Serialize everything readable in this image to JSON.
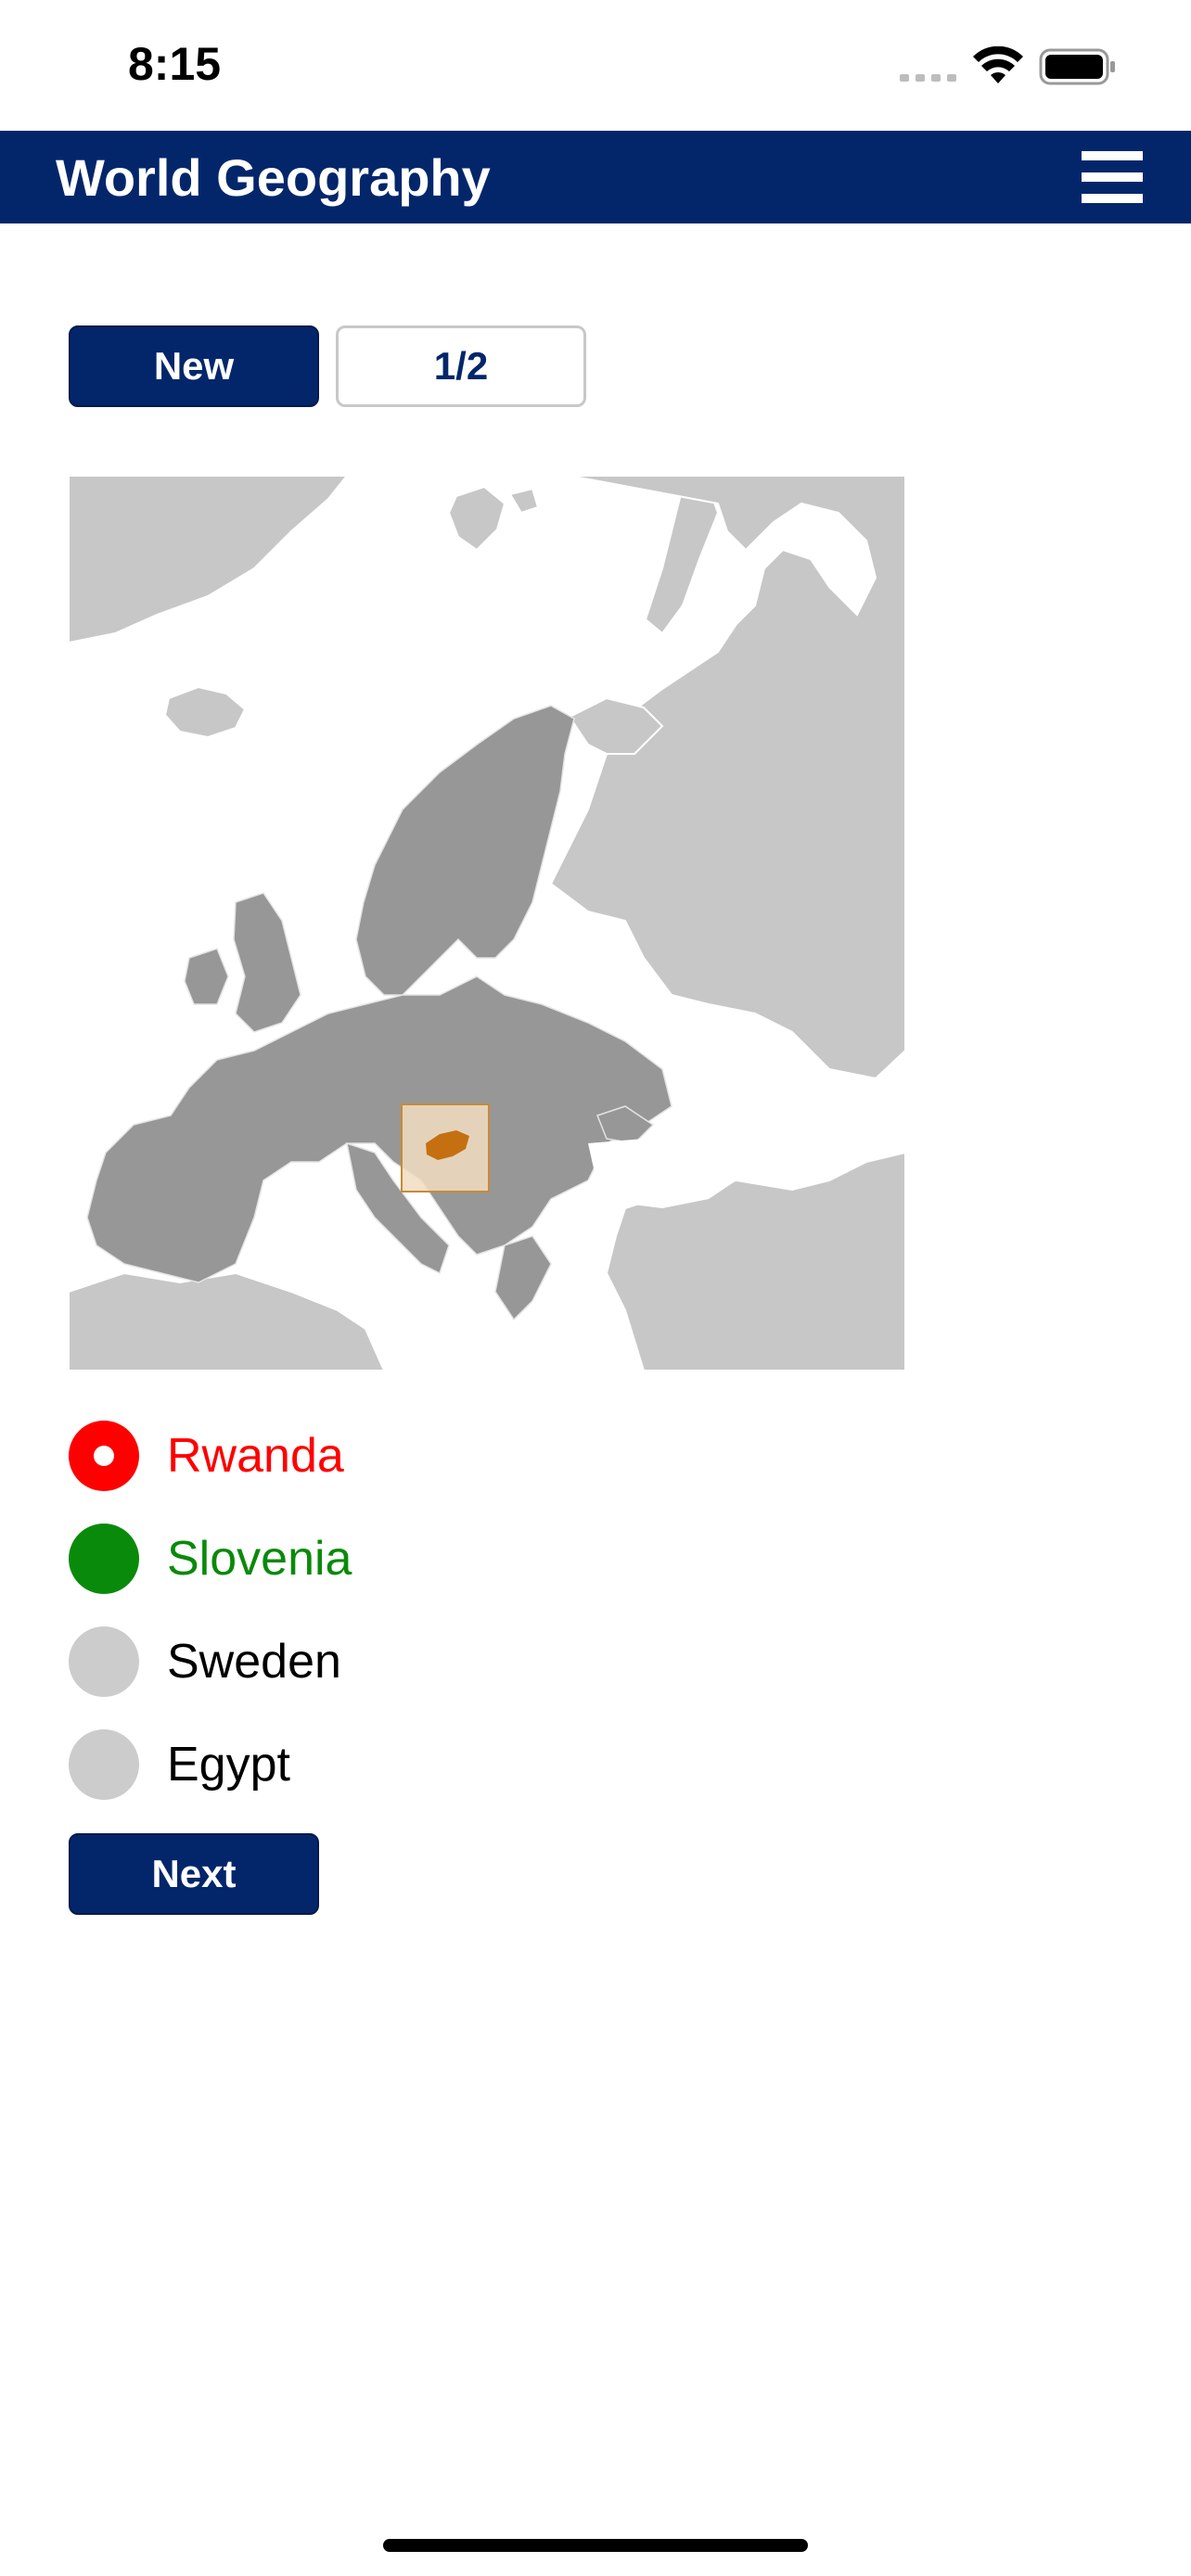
{
  "status_bar": {
    "time": "8:15",
    "icons": [
      "signal-dots-icon",
      "wifi-icon",
      "battery-icon"
    ]
  },
  "header": {
    "title": "World Geography",
    "menu_icon": "hamburger-menu-icon"
  },
  "toolbar": {
    "new_label": "New",
    "page_counter": "1/2"
  },
  "map": {
    "highlighted_country": "Slovenia"
  },
  "options": [
    {
      "label": "Rwanda",
      "state": "wrong"
    },
    {
      "label": "Slovenia",
      "state": "correct"
    },
    {
      "label": "Sweden",
      "state": "neutral"
    },
    {
      "label": "Egypt",
      "state": "neutral"
    }
  ],
  "next_label": "Next",
  "colors": {
    "brand": "#03266b",
    "wrong": "#ff0000",
    "correct": "#0a8a0a",
    "neutral": "#cccccc",
    "highlight": "#e08a10"
  }
}
